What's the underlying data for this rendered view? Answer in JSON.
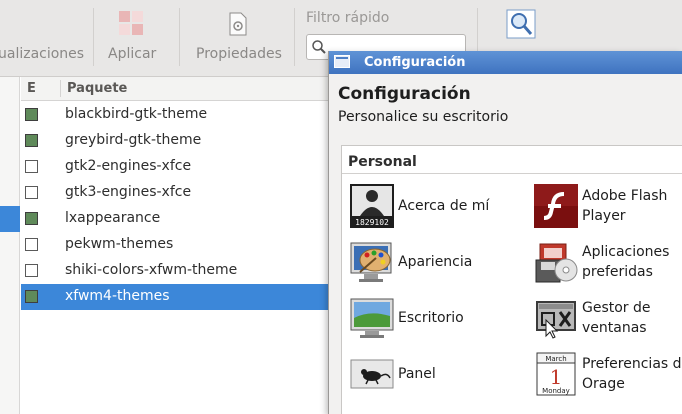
{
  "toolbar": {
    "updates_label": "ualizaciones",
    "apply_label": "Aplicar",
    "properties_label": "Propiedades",
    "filter_label": "Filtro rápido"
  },
  "package_list": {
    "headers": {
      "installed": "E",
      "package": "Paquete"
    },
    "rows": [
      {
        "name": "blackbird-gtk-theme",
        "checked": true
      },
      {
        "name": "greybird-gtk-theme",
        "checked": true
      },
      {
        "name": "gtk2-engines-xfce",
        "checked": false
      },
      {
        "name": "gtk3-engines-xfce",
        "checked": false
      },
      {
        "name": "lxappearance",
        "checked": true
      },
      {
        "name": "pekwm-themes",
        "checked": false
      },
      {
        "name": "shiki-colors-xfwm-theme",
        "checked": false
      },
      {
        "name": "xfwm4-themes",
        "checked": true,
        "selected": true
      }
    ]
  },
  "settings_window": {
    "title": "Configuración",
    "header_title": "Configuración",
    "header_subtitle": "Personalice su escritorio",
    "section": "Personal",
    "items": [
      {
        "label_lines": [
          "Acerca de mí"
        ],
        "icon": "person-id-card-icon",
        "id_number": "1829102"
      },
      {
        "label_lines": [
          "Adobe Flash",
          "Player"
        ],
        "icon": "adobe-flash-icon"
      },
      {
        "label_lines": [
          "Apariencia"
        ],
        "icon": "paint-palette-monitor-icon"
      },
      {
        "label_lines": [
          "Aplicaciones",
          "preferidas"
        ],
        "icon": "preferred-apps-icon"
      },
      {
        "label_lines": [
          "Escritorio"
        ],
        "icon": "desktop-monitor-icon"
      },
      {
        "label_lines": [
          "Gestor de",
          "ventanas"
        ],
        "icon": "window-manager-icon"
      },
      {
        "label_lines": [
          "Panel"
        ],
        "icon": "panel-mouse-icon"
      },
      {
        "label_lines": [
          "Preferencias de",
          "Orage"
        ],
        "icon": "calendar-icon"
      }
    ],
    "calendar_icon": {
      "month": "March",
      "day": "1",
      "weekday": "Monday"
    }
  },
  "colors": {
    "selection": "#3c87d9",
    "titlebar": "#4f83cb",
    "checkbox_on": "#5f8a5a"
  }
}
